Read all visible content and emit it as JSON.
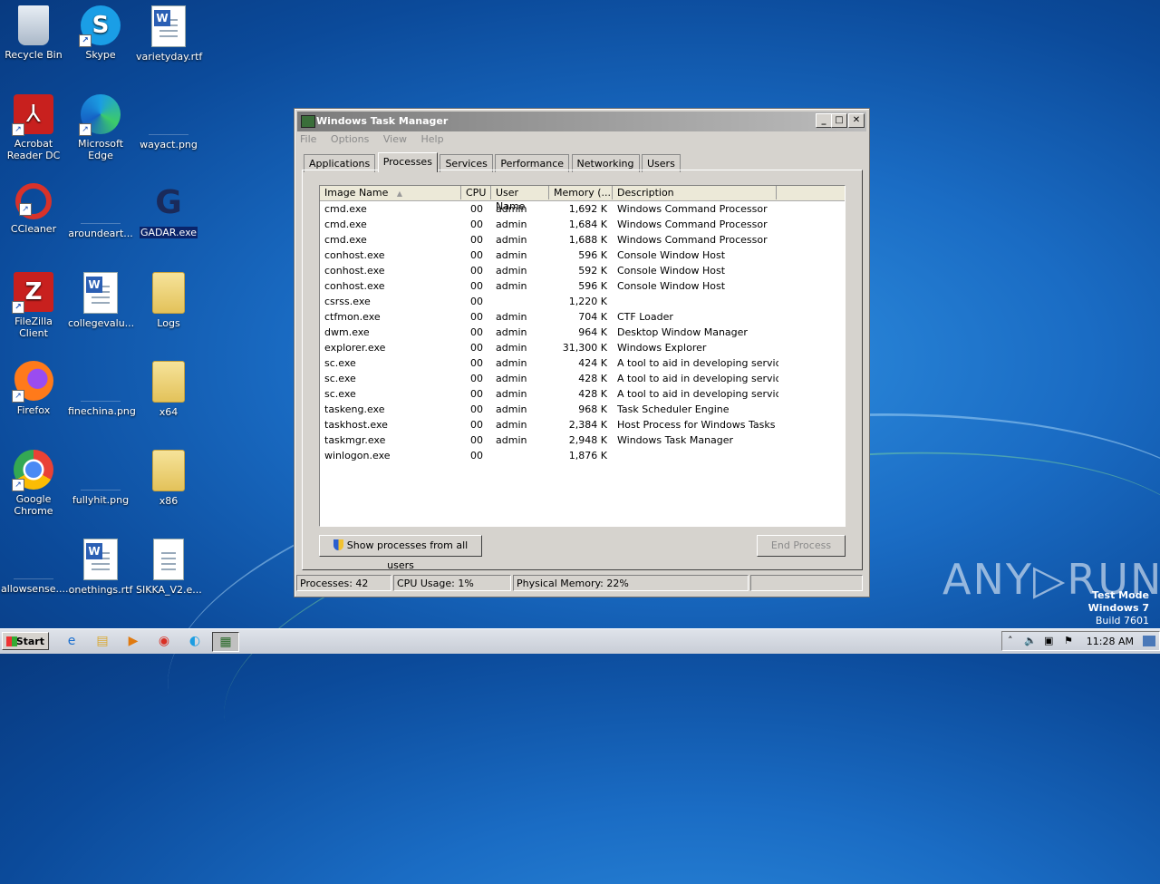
{
  "desktop_icons": [
    {
      "label": "Recycle Bin"
    },
    {
      "label": "Skype"
    },
    {
      "label": "varietyday.rtf"
    },
    {
      "label": "Acrobat Reader DC"
    },
    {
      "label": "Microsoft Edge"
    },
    {
      "label": "wayact.png"
    },
    {
      "label": "CCleaner"
    },
    {
      "label": "aroundeart..."
    },
    {
      "label": "GADAR.exe"
    },
    {
      "label": "FileZilla Client"
    },
    {
      "label": "collegevalu..."
    },
    {
      "label": "Logs"
    },
    {
      "label": "Firefox"
    },
    {
      "label": "finechina.png"
    },
    {
      "label": "x64"
    },
    {
      "label": "Google Chrome"
    },
    {
      "label": "fullyhit.png"
    },
    {
      "label": "x86"
    },
    {
      "label": "allowsense...."
    },
    {
      "label": "onethings.rtf"
    },
    {
      "label": "SIKKA_V2.e..."
    }
  ],
  "window": {
    "title": "Windows Task Manager",
    "menu": [
      "File",
      "Options",
      "View",
      "Help"
    ],
    "tabs": [
      "Applications",
      "Processes",
      "Services",
      "Performance",
      "Networking",
      "Users"
    ],
    "active_tab": "Processes",
    "columns": [
      "Image Name",
      "CPU",
      "User Name",
      "Memory (...",
      "Description"
    ],
    "rows": [
      {
        "name": "cmd.exe",
        "cpu": "00",
        "user": "admin",
        "mem": "1,692 K",
        "desc": "Windows Command Processor"
      },
      {
        "name": "cmd.exe",
        "cpu": "00",
        "user": "admin",
        "mem": "1,684 K",
        "desc": "Windows Command Processor"
      },
      {
        "name": "cmd.exe",
        "cpu": "00",
        "user": "admin",
        "mem": "1,688 K",
        "desc": "Windows Command Processor"
      },
      {
        "name": "conhost.exe",
        "cpu": "00",
        "user": "admin",
        "mem": "596 K",
        "desc": "Console Window Host"
      },
      {
        "name": "conhost.exe",
        "cpu": "00",
        "user": "admin",
        "mem": "592 K",
        "desc": "Console Window Host"
      },
      {
        "name": "conhost.exe",
        "cpu": "00",
        "user": "admin",
        "mem": "596 K",
        "desc": "Console Window Host"
      },
      {
        "name": "csrss.exe",
        "cpu": "00",
        "user": "",
        "mem": "1,220 K",
        "desc": ""
      },
      {
        "name": "ctfmon.exe",
        "cpu": "00",
        "user": "admin",
        "mem": "704 K",
        "desc": "CTF Loader"
      },
      {
        "name": "dwm.exe",
        "cpu": "00",
        "user": "admin",
        "mem": "964 K",
        "desc": "Desktop Window Manager"
      },
      {
        "name": "explorer.exe",
        "cpu": "00",
        "user": "admin",
        "mem": "31,300 K",
        "desc": "Windows Explorer"
      },
      {
        "name": "sc.exe",
        "cpu": "00",
        "user": "admin",
        "mem": "424 K",
        "desc": "A tool to aid in developing servic..."
      },
      {
        "name": "sc.exe",
        "cpu": "00",
        "user": "admin",
        "mem": "428 K",
        "desc": "A tool to aid in developing servic..."
      },
      {
        "name": "sc.exe",
        "cpu": "00",
        "user": "admin",
        "mem": "428 K",
        "desc": "A tool to aid in developing servic..."
      },
      {
        "name": "taskeng.exe",
        "cpu": "00",
        "user": "admin",
        "mem": "968 K",
        "desc": "Task Scheduler Engine"
      },
      {
        "name": "taskhost.exe",
        "cpu": "00",
        "user": "admin",
        "mem": "2,384 K",
        "desc": "Host Process for Windows Tasks"
      },
      {
        "name": "taskmgr.exe",
        "cpu": "00",
        "user": "admin",
        "mem": "2,948 K",
        "desc": "Windows Task Manager"
      },
      {
        "name": "winlogon.exe",
        "cpu": "00",
        "user": "",
        "mem": "1,876 K",
        "desc": ""
      }
    ],
    "show_all_label": "Show processes from all users",
    "end_process_label": "End Process",
    "status": {
      "processes": "Processes: 42",
      "cpu": "CPU Usage: 1%",
      "memory": "Physical Memory: 22%"
    }
  },
  "taskbar": {
    "start_label": "Start",
    "clock": "11:28 AM"
  },
  "watermark": {
    "line1": "Test Mode",
    "line2": "Windows 7",
    "line3": "Build 7601",
    "brand": "ANY RUN"
  }
}
